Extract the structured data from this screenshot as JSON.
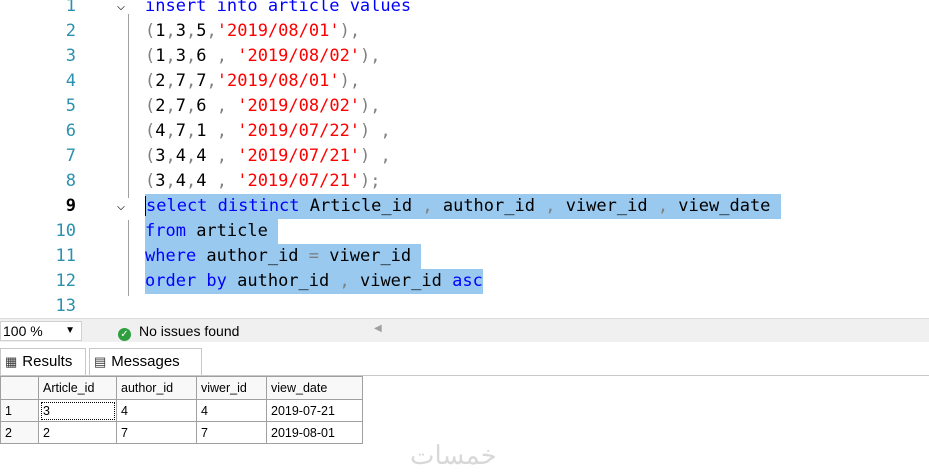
{
  "editor": {
    "lines": [
      {
        "num": "1",
        "fold": "v",
        "tokens": [
          {
            "t": "insert into article values",
            "c": "kw"
          }
        ]
      },
      {
        "num": "2",
        "tokens": [
          {
            "t": "(",
            "c": "gray"
          },
          {
            "t": "1",
            "c": "plain"
          },
          {
            "t": ",",
            "c": "gray"
          },
          {
            "t": "3",
            "c": "plain"
          },
          {
            "t": ",",
            "c": "gray"
          },
          {
            "t": "5",
            "c": "plain"
          },
          {
            "t": ",",
            "c": "gray"
          },
          {
            "t": "'2019/08/01'",
            "c": "str"
          },
          {
            "t": "),",
            "c": "gray"
          }
        ]
      },
      {
        "num": "3",
        "tokens": [
          {
            "t": "(",
            "c": "gray"
          },
          {
            "t": "1",
            "c": "plain"
          },
          {
            "t": ",",
            "c": "gray"
          },
          {
            "t": "3",
            "c": "plain"
          },
          {
            "t": ",",
            "c": "gray"
          },
          {
            "t": "6 ",
            "c": "plain"
          },
          {
            "t": ", ",
            "c": "gray"
          },
          {
            "t": "'2019/08/02'",
            "c": "str"
          },
          {
            "t": "),",
            "c": "gray"
          }
        ]
      },
      {
        "num": "4",
        "tokens": [
          {
            "t": "(",
            "c": "gray"
          },
          {
            "t": "2",
            "c": "plain"
          },
          {
            "t": ",",
            "c": "gray"
          },
          {
            "t": "7",
            "c": "plain"
          },
          {
            "t": ",",
            "c": "gray"
          },
          {
            "t": "7",
            "c": "plain"
          },
          {
            "t": ",",
            "c": "gray"
          },
          {
            "t": "'2019/08/01'",
            "c": "str"
          },
          {
            "t": "),",
            "c": "gray"
          }
        ]
      },
      {
        "num": "5",
        "tokens": [
          {
            "t": "(",
            "c": "gray"
          },
          {
            "t": "2",
            "c": "plain"
          },
          {
            "t": ",",
            "c": "gray"
          },
          {
            "t": "7",
            "c": "plain"
          },
          {
            "t": ",",
            "c": "gray"
          },
          {
            "t": "6 ",
            "c": "plain"
          },
          {
            "t": ", ",
            "c": "gray"
          },
          {
            "t": "'2019/08/02'",
            "c": "str"
          },
          {
            "t": "),",
            "c": "gray"
          }
        ]
      },
      {
        "num": "6",
        "tokens": [
          {
            "t": "(",
            "c": "gray"
          },
          {
            "t": "4",
            "c": "plain"
          },
          {
            "t": ",",
            "c": "gray"
          },
          {
            "t": "7",
            "c": "plain"
          },
          {
            "t": ",",
            "c": "gray"
          },
          {
            "t": "1 ",
            "c": "plain"
          },
          {
            "t": ", ",
            "c": "gray"
          },
          {
            "t": "'2019/07/22'",
            "c": "str"
          },
          {
            "t": ") ,",
            "c": "gray"
          }
        ]
      },
      {
        "num": "7",
        "tokens": [
          {
            "t": "(",
            "c": "gray"
          },
          {
            "t": "3",
            "c": "plain"
          },
          {
            "t": ",",
            "c": "gray"
          },
          {
            "t": "4",
            "c": "plain"
          },
          {
            "t": ",",
            "c": "gray"
          },
          {
            "t": "4 ",
            "c": "plain"
          },
          {
            "t": ", ",
            "c": "gray"
          },
          {
            "t": "'2019/07/21'",
            "c": "str"
          },
          {
            "t": ") ,",
            "c": "gray"
          }
        ]
      },
      {
        "num": "8",
        "tokens": [
          {
            "t": "(",
            "c": "gray"
          },
          {
            "t": "3",
            "c": "plain"
          },
          {
            "t": ",",
            "c": "gray"
          },
          {
            "t": "4",
            "c": "plain"
          },
          {
            "t": ",",
            "c": "gray"
          },
          {
            "t": "4 ",
            "c": "plain"
          },
          {
            "t": ", ",
            "c": "gray"
          },
          {
            "t": "'2019/07/21'",
            "c": "str"
          },
          {
            "t": ");",
            "c": "gray"
          }
        ]
      },
      {
        "num": "9",
        "fold": "v",
        "active": true,
        "selected": true,
        "tokens": [
          {
            "t": "select distinct ",
            "c": "kw"
          },
          {
            "t": "Article_id ",
            "c": "plain"
          },
          {
            "t": ", ",
            "c": "gray"
          },
          {
            "t": "author_id ",
            "c": "plain"
          },
          {
            "t": ", ",
            "c": "gray"
          },
          {
            "t": "viwer_id ",
            "c": "plain"
          },
          {
            "t": ", ",
            "c": "gray"
          },
          {
            "t": "view_date ",
            "c": "plain"
          }
        ]
      },
      {
        "num": "10",
        "selected": true,
        "tokens": [
          {
            "t": "from ",
            "c": "kw"
          },
          {
            "t": "article ",
            "c": "plain"
          }
        ]
      },
      {
        "num": "11",
        "selected": true,
        "tokens": [
          {
            "t": "where ",
            "c": "kw"
          },
          {
            "t": "author_id ",
            "c": "plain"
          },
          {
            "t": "= ",
            "c": "gray"
          },
          {
            "t": "viwer_id ",
            "c": "plain"
          }
        ]
      },
      {
        "num": "12",
        "selected": true,
        "tokens": [
          {
            "t": "order by ",
            "c": "kw"
          },
          {
            "t": "author_id ",
            "c": "plain"
          },
          {
            "t": ", ",
            "c": "gray"
          },
          {
            "t": "viwer_id ",
            "c": "plain"
          },
          {
            "t": "asc",
            "c": "kw"
          }
        ]
      },
      {
        "num": "13",
        "tokens": []
      }
    ]
  },
  "status": {
    "zoom": "100 %",
    "issues": "No issues found"
  },
  "tabs": [
    {
      "label": "Results",
      "icon": "grid-icon"
    },
    {
      "label": "Messages",
      "icon": "messages-icon"
    }
  ],
  "results": {
    "columns": [
      "Article_id",
      "author_id",
      "viwer_id",
      "view_date"
    ],
    "rows": [
      {
        "num": "1",
        "cells": [
          "3",
          "4",
          "4",
          "2019-07-21"
        ]
      },
      {
        "num": "2",
        "cells": [
          "2",
          "7",
          "7",
          "2019-08-01"
        ]
      }
    ]
  },
  "watermark": "خمسات",
  "colors": {
    "keyword": "#0000ff",
    "string": "#ff0000",
    "line_number": "#2b91af",
    "selection": "#99c9ef",
    "ok": "#2e9e3e"
  }
}
